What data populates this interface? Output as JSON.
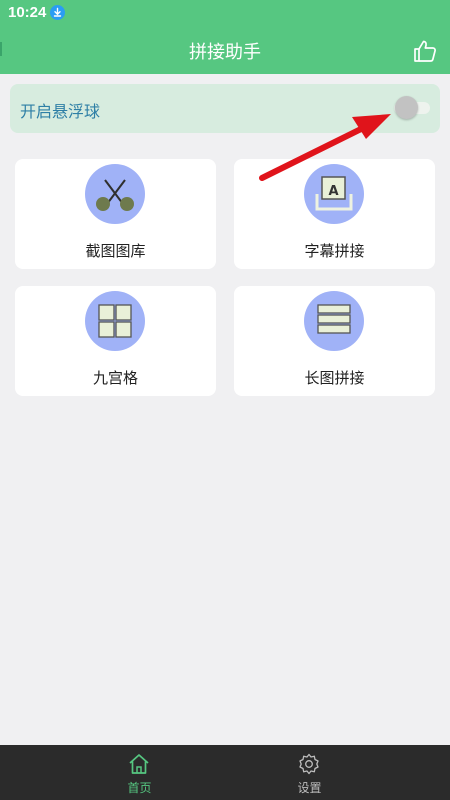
{
  "status_bar": {
    "time": "10:24",
    "download_icon": "download-icon"
  },
  "app_bar": {
    "title": "拼接助手",
    "like_icon": "thumbs-up-icon"
  },
  "float_ball": {
    "label": "开启悬浮球",
    "enabled": false
  },
  "grid": [
    {
      "label": "截图图库",
      "icon": "scissors-icon"
    },
    {
      "label": "字幕拼接",
      "icon": "subtitle-frame-icon"
    },
    {
      "label": "九宫格",
      "icon": "grid-nine-icon"
    },
    {
      "label": "长图拼接",
      "icon": "stacked-strips-icon"
    }
  ],
  "bottom_nav": [
    {
      "label": "首页",
      "icon": "home-icon",
      "active": true
    },
    {
      "label": "设置",
      "icon": "gear-icon",
      "active": false
    }
  ],
  "colors": {
    "primary_green": "#56c781",
    "icon_circle": "#a0b2f7",
    "annotation_arrow": "#e0141b",
    "nav_background": "#2b2b2b"
  }
}
